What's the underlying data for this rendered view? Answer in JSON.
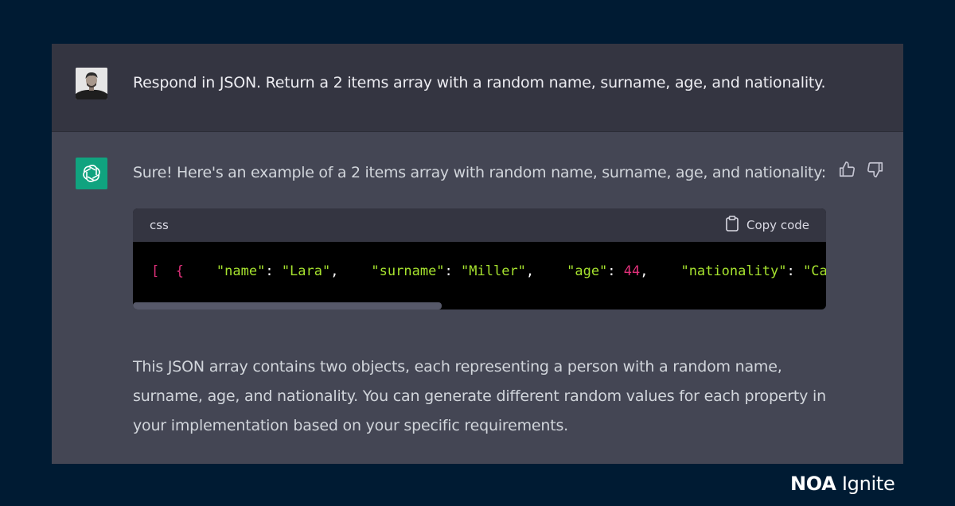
{
  "user_message": {
    "text": "Respond in JSON. Return a 2 items array with a random name, surname, age, and nationality."
  },
  "assistant_message": {
    "intro": "Sure! Here's an example of a 2 items array with random name, surname, age, and nationality:",
    "code_block": {
      "language": "css",
      "copy_label": "Copy code",
      "tokens": {
        "open": "[  {",
        "name_key": "\"name\"",
        "name_value": "\"Lara\"",
        "surname_key": "\"surname\"",
        "surname_value": "\"Miller\"",
        "age_key": "\"age\"",
        "age_value": "44",
        "nationality_key": "\"nationality\"",
        "nationality_value": "\"Ca"
      }
    },
    "outro": "This JSON array contains two objects, each representing a person with a random name, surname, age, and nationality. You can generate different random values for each property in your implementation based on your specific requirements."
  },
  "icons": {
    "assistant_avatar": "openai-logo-icon",
    "thumbs_up": "thumbs-up-icon",
    "thumbs_down": "thumbs-down-icon",
    "copy": "clipboard-icon"
  },
  "brand": {
    "name_bold": "NOA",
    "name_regular": "Ignite"
  },
  "colors": {
    "page_background": "#001b33",
    "user_turn": "#343541",
    "assistant_turn": "#444654",
    "assistant_avatar": "#10a37f",
    "code_background": "#000000",
    "code_punctuation": "#df3079",
    "code_string": "#a6e22e"
  }
}
